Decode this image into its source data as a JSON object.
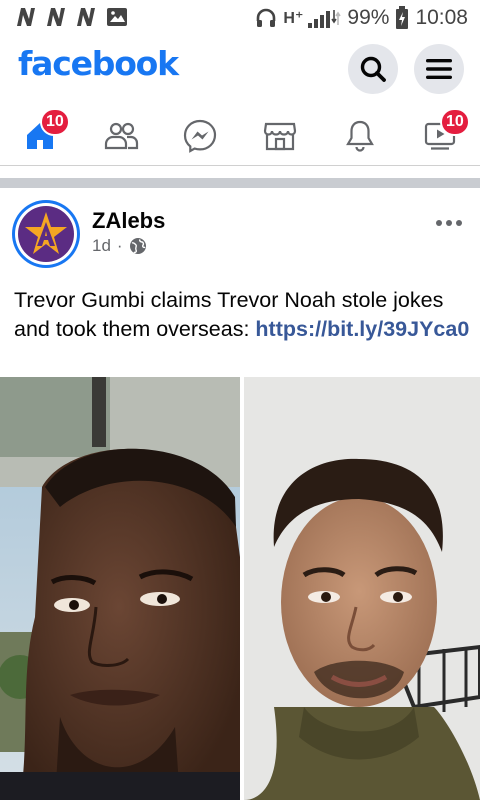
{
  "status_bar": {
    "network": "H⁺",
    "battery": "99%",
    "time": "10:08"
  },
  "header": {
    "logo": "facebook",
    "search_icon": "search-icon",
    "menu_icon": "hamburger-menu-icon"
  },
  "tabs": [
    {
      "name": "home",
      "icon": "home-icon",
      "badge": "10",
      "active": true
    },
    {
      "name": "friends",
      "icon": "friends-icon",
      "badge": ""
    },
    {
      "name": "messenger",
      "icon": "messenger-icon",
      "badge": ""
    },
    {
      "name": "marketplace",
      "icon": "marketplace-icon",
      "badge": ""
    },
    {
      "name": "notifications",
      "icon": "bell-icon",
      "badge": ""
    },
    {
      "name": "watch",
      "icon": "video-icon",
      "badge": "10"
    }
  ],
  "post": {
    "author": "ZAlebs",
    "time": "1d",
    "separator": "·",
    "audience_icon": "globe-icon",
    "text": "Trevor Gumbi claims Trevor Noah stole jokes and took them overseas: ",
    "link": "https://bit.ly/39JYca0"
  },
  "colors": {
    "brand": "#1877f2",
    "badge": "#e41e3f",
    "link": "#385898",
    "icon_gray": "#65676b"
  }
}
